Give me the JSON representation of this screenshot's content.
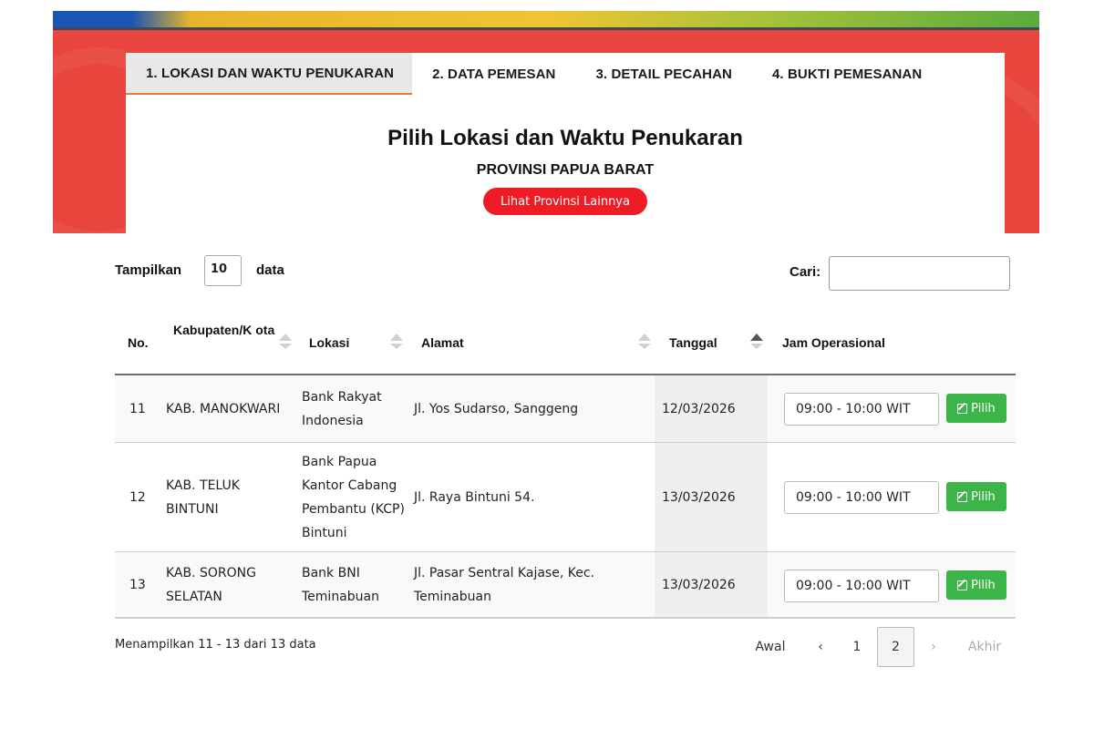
{
  "steps": [
    {
      "label": "1. LOKASI DAN WAKTU PENUKARAN",
      "active": true
    },
    {
      "label": "2. DATA PEMESAN",
      "active": false
    },
    {
      "label": "3. DETAIL PECAHAN",
      "active": false
    },
    {
      "label": "4. BUKTI PEMESANAN",
      "active": false
    }
  ],
  "panel": {
    "title": "Pilih Lokasi dan Waktu Penukaran",
    "province": "PROVINSI PAPUA BARAT",
    "other_province_button": "Lihat Provinsi Lainnya"
  },
  "controls": {
    "show_prefix": "Tampilkan",
    "page_length": "10",
    "show_suffix": "data",
    "search_label": "Cari:",
    "search_value": ""
  },
  "table": {
    "columns": [
      "No.",
      "Kabupaten/K ota",
      "Lokasi",
      "Alamat",
      "Tanggal",
      "Jam Operasional"
    ],
    "rows": [
      {
        "no": "11",
        "kab": "KAB. MANOKWARI",
        "lokasi": "Bank Rakyat Indonesia",
        "alamat": "Jl. Yos Sudarso, Sanggeng",
        "tanggal": "12/03/2026",
        "jam": "09:00 - 10:00 WIT",
        "action": "Pilih"
      },
      {
        "no": "12",
        "kab": "KAB. TELUK BINTUNI",
        "lokasi": "Bank Papua Kantor Cabang Pembantu (KCP) Bintuni",
        "alamat": "Jl. Raya Bintuni 54.",
        "tanggal": "13/03/2026",
        "jam": "09:00 - 10:00 WIT",
        "action": "Pilih"
      },
      {
        "no": "13",
        "kab": "KAB. SORONG SELATAN",
        "lokasi": "Bank BNI Teminabuan",
        "alamat": "Jl. Pasar Sentral Kajase, Kec. Teminabuan",
        "tanggal": "13/03/2026",
        "jam": "09:00 - 10:00 WIT",
        "action": "Pilih"
      }
    ]
  },
  "footer": {
    "info": "Menampilkan 11 - 13 dari 13 data",
    "first": "Awal",
    "prev": "‹",
    "pages": [
      "1",
      "2"
    ],
    "current_page": "2",
    "next": "›",
    "last": "Akhir"
  },
  "colors": {
    "banner_red": "#e8453c",
    "button_red": "#ee1c25",
    "action_green": "#3cb548",
    "active_tab_underline": "#e87a3c"
  },
  "icons": {
    "sort_neutral": "sort-icon",
    "sort_asc": "sort-asc-icon",
    "edit": "edit-icon"
  }
}
